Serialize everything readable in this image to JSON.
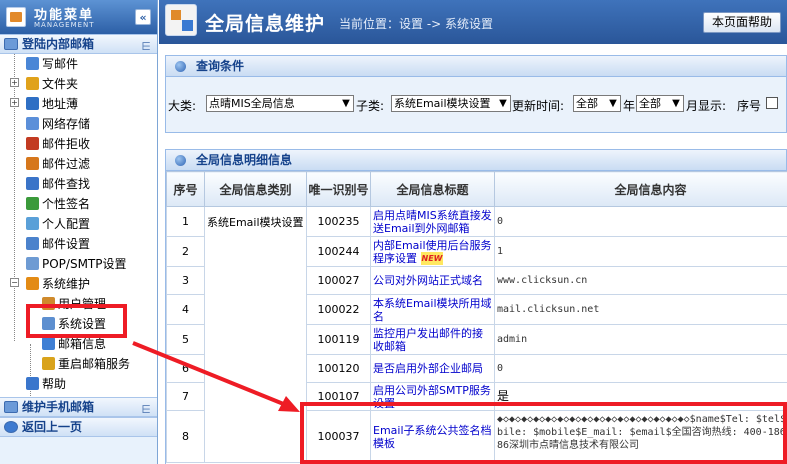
{
  "sidebar": {
    "title": "功能菜单",
    "subtitle": "MANAGEMENT",
    "collapse_glyph": "«",
    "section_login": "登陆内部邮箱",
    "section_mobile": "维护手机邮箱",
    "section_back": "返回上一页",
    "items": [
      {
        "label": "写邮件",
        "color": "#4a86d6"
      },
      {
        "label": "文件夹",
        "color": "#e0a21b"
      },
      {
        "label": "地址薄",
        "color": "#2f6fc4"
      },
      {
        "label": "网络存储",
        "color": "#5b8fd9"
      },
      {
        "label": "邮件拒收",
        "color": "#c23b22"
      },
      {
        "label": "邮件过滤",
        "color": "#d6771c"
      },
      {
        "label": "邮件查找",
        "color": "#3a74c8"
      },
      {
        "label": "个性签名",
        "color": "#3b9a3b"
      },
      {
        "label": "个人配置",
        "color": "#5aa0d8"
      },
      {
        "label": "邮件设置",
        "color": "#4b82cc"
      },
      {
        "label": "POP/SMTP设置",
        "color": "#6e9bd3"
      },
      {
        "label": "系统维护",
        "color": "#e38b15"
      },
      {
        "label": "用户管理",
        "color": "#cf8a2c"
      },
      {
        "label": "系统设置",
        "color": "#5d8fd0"
      },
      {
        "label": "邮箱信息",
        "color": "#3f7fd4"
      },
      {
        "label": "重启邮箱服务",
        "color": "#d9a31c"
      },
      {
        "label": "帮助",
        "color": "#3a76cc"
      }
    ]
  },
  "header": {
    "title": "全局信息维护",
    "breadcrumb": "当前位置：设置 -> 系统设置",
    "help_button": "本页面帮助"
  },
  "query": {
    "panel_title": "查询条件",
    "category_label": "大类:",
    "category_value": "点晴MIS全局信息",
    "subcategory_label": "子类:",
    "subcategory_value": "系统Email模块设置",
    "update_time_label": "更新时间:",
    "year_value": "全部",
    "year_suffix": "年",
    "month_value": "全部",
    "month_suffix": "月显示:",
    "seq_label": "序号"
  },
  "table": {
    "panel_title": "全局信息明细信息",
    "headers": [
      "序号",
      "全局信息类别",
      "唯一识别号",
      "全局信息标题",
      "全局信息内容"
    ],
    "category_cell": "系统Email模块设置",
    "rows": [
      {
        "no": "1",
        "id": "100235",
        "title": "启用点晴MIS系统直接发送Email到外网邮箱",
        "content": "0"
      },
      {
        "no": "2",
        "id": "100244",
        "title": "内部Email使用后台服务程序设置",
        "badge": "NEW",
        "content": "1"
      },
      {
        "no": "3",
        "id": "100027",
        "title": "公司对外网站正式域名",
        "content": "www.clicksun.cn"
      },
      {
        "no": "4",
        "id": "100022",
        "title": "本系统Email模块所用域名",
        "content": "mail.clicksun.net"
      },
      {
        "no": "5",
        "id": "100119",
        "title": "监控用户发出邮件的接收邮箱",
        "content": "admin"
      },
      {
        "no": "6",
        "id": "100120",
        "title": "是否启用外部企业邮局",
        "content": "0"
      },
      {
        "no": "7",
        "id": "100107",
        "title": "启用公司外部SMTP服务设置",
        "content": "是"
      },
      {
        "no": "8",
        "id": "100037",
        "title": "Email子系统公共签名档模板",
        "content": "◆◇◆◇◆◇◆◇◆◇◆◇◆◇◆◇◆◇◆◇◆◇◆◇◆◇◆◇◆◇◆◇$name$Tel: $tel$Mobile: $mobile$E_mail: $email$全国咨询热线: 400-186-1886深圳市点晴信息技术有限公司"
      }
    ]
  },
  "annotation": {
    "highlight_color": "#ee1c25"
  }
}
